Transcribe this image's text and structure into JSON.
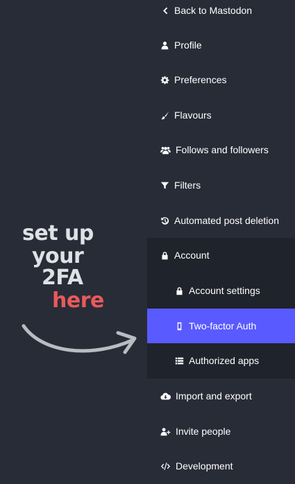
{
  "annotation": {
    "lines": [
      "set up",
      "your",
      "2FA",
      "here"
    ],
    "text_color": "#dfe1e6",
    "accent_color": "#e85a5a",
    "arrow_color": "#b9bcc2"
  },
  "colors": {
    "background": "#282c37",
    "submenu_background": "#1f232b",
    "active": "#595aff"
  },
  "nav": {
    "back": {
      "label": "Back to Mastodon",
      "icon": "chevron-left-icon"
    },
    "profile": {
      "label": "Profile",
      "icon": "user-icon"
    },
    "preferences": {
      "label": "Preferences",
      "icon": "gear-icon"
    },
    "flavours": {
      "label": "Flavours",
      "icon": "paint-brush-icon"
    },
    "follows": {
      "label": "Follows and followers",
      "icon": "users-icon"
    },
    "filters": {
      "label": "Filters",
      "icon": "filter-icon"
    },
    "deletion": {
      "label": "Automated post deletion",
      "icon": "history-icon"
    },
    "account": {
      "label": "Account",
      "icon": "lock-icon"
    },
    "account_settings": {
      "label": "Account settings",
      "icon": "lock-icon"
    },
    "two_factor": {
      "label": "Two-factor Auth",
      "icon": "mobile-icon"
    },
    "authorized_apps": {
      "label": "Authorized apps",
      "icon": "list-icon"
    },
    "import_export": {
      "label": "Import and export",
      "icon": "cloud-download-icon"
    },
    "invite": {
      "label": "Invite people",
      "icon": "user-plus-icon"
    },
    "development": {
      "label": "Development",
      "icon": "code-icon"
    }
  }
}
